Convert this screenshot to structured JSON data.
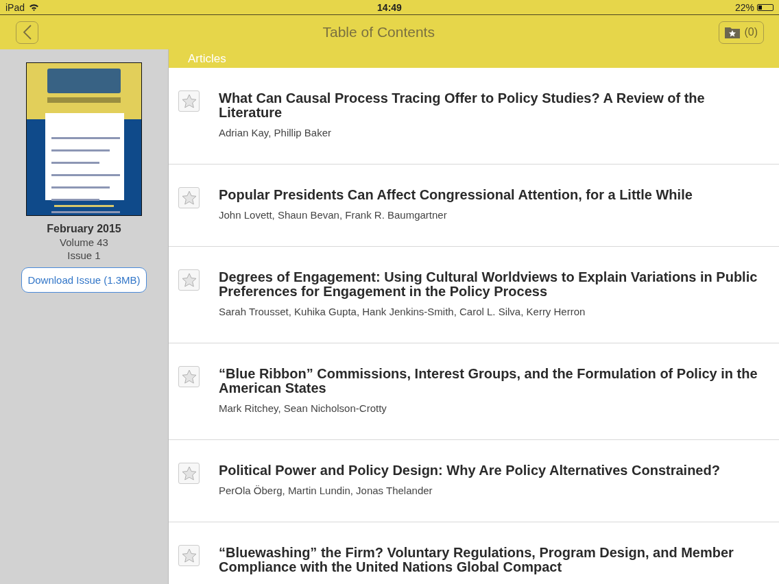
{
  "status_bar": {
    "device": "iPad",
    "time": "14:49",
    "battery_text": "22%"
  },
  "nav": {
    "title": "Table of Contents",
    "favorites_count": "(0)"
  },
  "issue": {
    "date": "February 2015",
    "volume": "Volume 43",
    "number": "Issue 1",
    "download_button": "Download Issue (1.3MB)"
  },
  "section": {
    "title": "Articles"
  },
  "articles": [
    {
      "title": "What Can Causal Process Tracing Offer to Policy Studies? A Review of the Literature",
      "authors": "Adrian Kay, Phillip Baker",
      "starred": false
    },
    {
      "title": "Popular Presidents Can Affect Congressional Attention, for a Little While",
      "authors": "John Lovett, Shaun Bevan, Frank R. Baumgartner",
      "starred": false
    },
    {
      "title": "Degrees of Engagement: Using Cultural Worldviews to Explain Variations in Public Preferences for Engagement in the Policy Process",
      "authors": "Sarah Trousset, Kuhika Gupta, Hank Jenkins-Smith, Carol L. Silva, Kerry Herron",
      "starred": false
    },
    {
      "title": "“Blue Ribbon” Commissions, Interest Groups, and the Formulation of Policy in the American States",
      "authors": "Mark Ritchey, Sean Nicholson-Crotty",
      "starred": false
    },
    {
      "title": "Political Power and Policy Design: Why Are Policy Alternatives Constrained?",
      "authors": "PerOla Öberg, Martin Lundin, Jonas Thelander",
      "starred": false
    },
    {
      "title": "“Bluewashing” the Firm? Voluntary Regulations, Program Design, and Member Compliance with the United Nations Global Compact",
      "starred": false
    }
  ]
}
